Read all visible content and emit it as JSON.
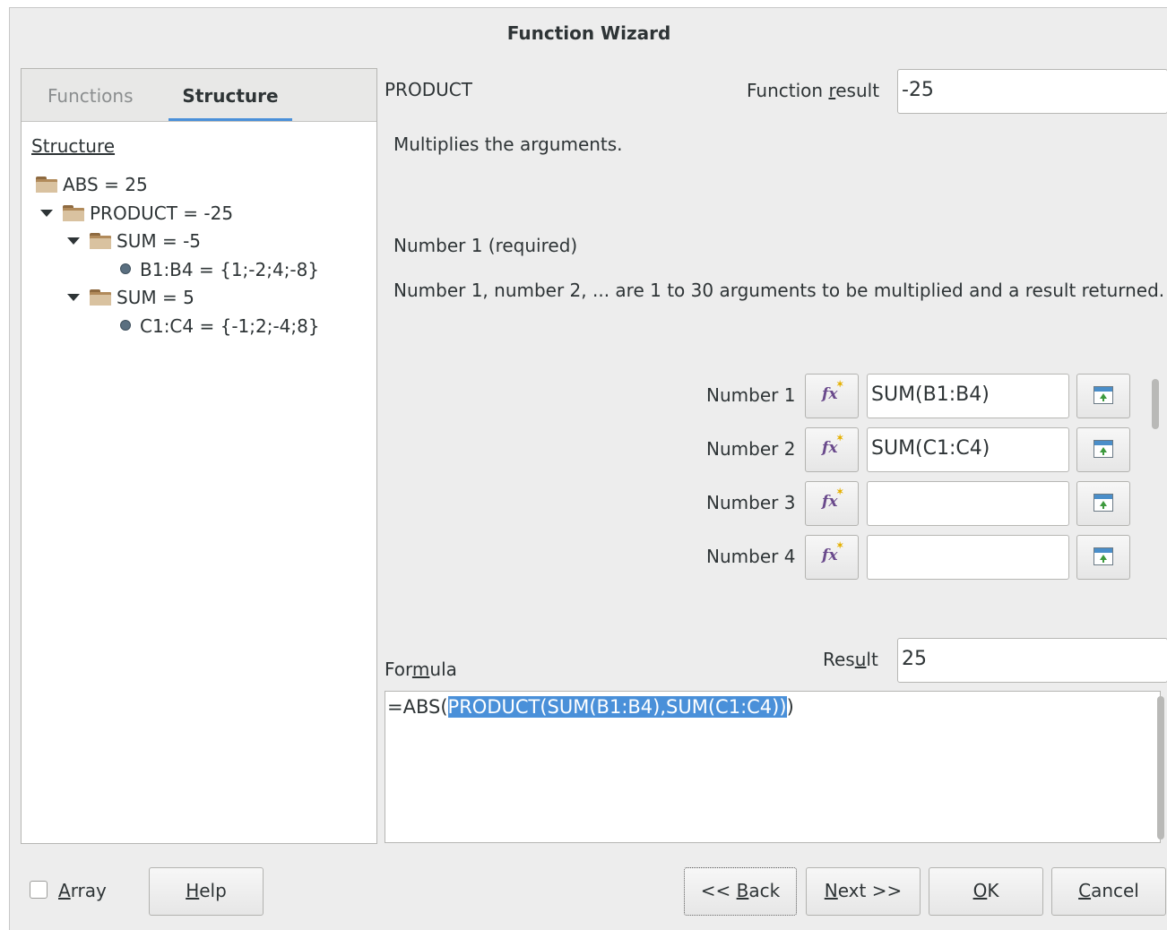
{
  "window": {
    "title": "Function Wizard"
  },
  "tabs": {
    "functions": "Functions",
    "structure": "Structure"
  },
  "tree": {
    "title": "Structure",
    "nodes": [
      {
        "label": "ABS = 25",
        "icon": "folder-icon"
      },
      {
        "label": "PRODUCT = -25",
        "icon": "folder-icon"
      },
      {
        "label": "SUM = -5",
        "icon": "folder-icon"
      },
      {
        "label": "B1:B4 = {1;-2;4;-8}",
        "icon": "bullet-icon"
      },
      {
        "label": "SUM = 5",
        "icon": "folder-icon"
      },
      {
        "label": "C1:C4 = {-1;2;-4;8}",
        "icon": "bullet-icon"
      }
    ]
  },
  "function": {
    "name": "PRODUCT",
    "result_label": "Function result",
    "result_value": "-25",
    "description": "Multiplies the arguments.",
    "arg_title": "Number 1 (required)",
    "arg_description": "Number 1, number 2, ... are 1 to 30 arguments to be multiplied and a result returned."
  },
  "args": [
    {
      "label": "Number 1",
      "value": "SUM(B1:B4)"
    },
    {
      "label": "Number 2",
      "value": "SUM(C1:C4)"
    },
    {
      "label": "Number 3",
      "value": ""
    },
    {
      "label": "Number 4",
      "value": ""
    }
  ],
  "formula": {
    "label": "Formula",
    "result_label": "Result",
    "result_value": "25",
    "prefix": "=ABS(",
    "selected": "PRODUCT(SUM(B1:B4),SUM(C1:C4))",
    "suffix": ")"
  },
  "buttons": {
    "array": "Array",
    "help": "Help",
    "back": "<< Back",
    "next": "Next >>",
    "ok": "OK",
    "cancel": "Cancel"
  },
  "colors": {
    "selection": "#4a90d9",
    "tab_underline": "#4a90d9"
  }
}
